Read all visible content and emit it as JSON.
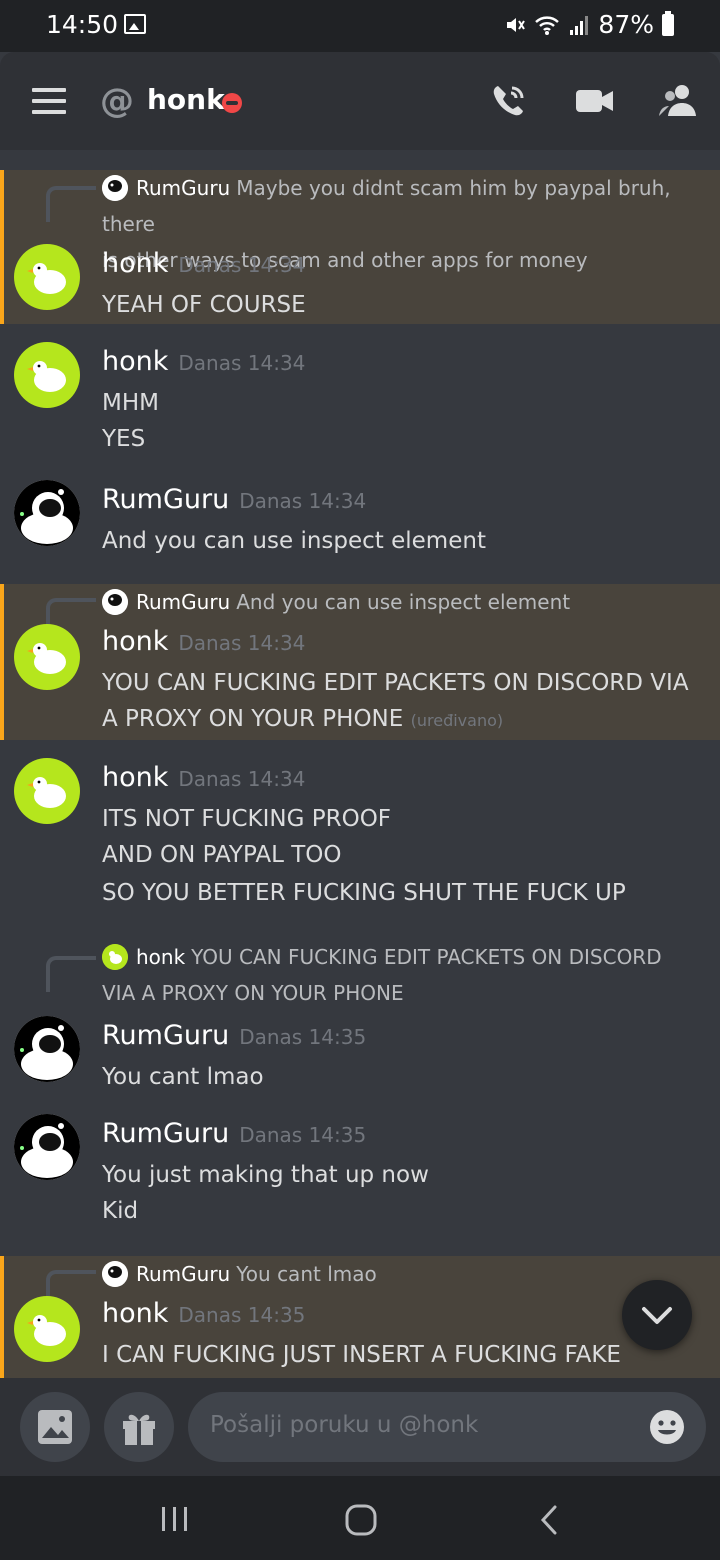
{
  "status_bar": {
    "time": "14:50",
    "battery": "87%"
  },
  "header": {
    "at_symbol": "@",
    "name": "honk"
  },
  "messages": [
    {
      "reply": {
        "author": "RumGuru",
        "text_line1": "Maybe you didnt scam him by paypal bruh, there",
        "text_line2": "is other ways to scam and other apps for money"
      },
      "author": "honk",
      "timestamp": "Danas 14:34",
      "lines": [
        "YEAH OF COURSE"
      ]
    },
    {
      "author": "honk",
      "timestamp": "Danas 14:34",
      "lines": [
        "MHM",
        "YES"
      ]
    },
    {
      "author": "RumGuru",
      "timestamp": "Danas 14:34",
      "lines": [
        "And you can use inspect element"
      ]
    },
    {
      "reply": {
        "author": "RumGuru",
        "text_line1": "And you can use inspect element"
      },
      "author": "honk",
      "timestamp": "Danas 14:34",
      "lines": [
        "YOU CAN FUCKING EDIT PACKETS ON DISCORD VIA",
        "A PROXY ON YOUR PHONE"
      ],
      "edited": "(uređivano)"
    },
    {
      "author": "honk",
      "timestamp": "Danas 14:34",
      "lines": [
        "ITS NOT FUCKING PROOF",
        "AND ON PAYPAL TOO",
        "SO YOU BETTER FUCKING SHUT THE FUCK UP"
      ]
    },
    {
      "reply": {
        "author": "honk",
        "text_line1": "YOU CAN FUCKING EDIT PACKETS ON DISCORD",
        "text_line2": "VIA A PROXY ON YOUR PHONE"
      },
      "author": "RumGuru",
      "timestamp": "Danas 14:35",
      "lines": [
        "You cant lmao"
      ]
    },
    {
      "author": "RumGuru",
      "timestamp": "Danas 14:35",
      "lines": [
        "You just making that up now",
        "Kid"
      ]
    },
    {
      "reply": {
        "author": "RumGuru",
        "text_line1": "You cant lmao"
      },
      "author": "honk",
      "timestamp": "Danas 14:35",
      "lines": [
        "I CAN FUCKING JUST INSERT A FUCKING FAKE"
      ]
    }
  ],
  "composer": {
    "placeholder": "Pošalji poruku u @honk"
  },
  "colors": {
    "mention_bg": "#49443c",
    "mention_bar": "#faa61a",
    "bg": "#36393f",
    "header_bg": "#2f3136",
    "dnd": "#f04747",
    "goose_avatar": "#b5e61d"
  }
}
